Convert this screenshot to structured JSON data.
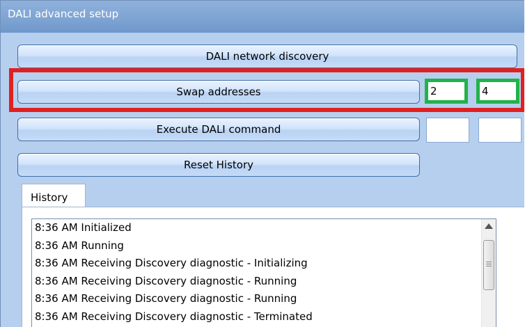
{
  "window": {
    "title": "DALI advanced setup"
  },
  "buttons": {
    "discovery": "DALI network discovery",
    "swap": "Swap addresses",
    "execute": "Execute DALI command",
    "reset": "Reset History"
  },
  "swap_fields": {
    "first": "2",
    "second": "4"
  },
  "command_fields": {
    "first": "",
    "second": ""
  },
  "tabs": [
    {
      "label": "History"
    }
  ],
  "history": [
    "8:36 AM Initialized",
    "8:36 AM Running",
    "8:36 AM Receiving Discovery diagnostic - Initializing",
    "8:36 AM Receiving Discovery diagnostic - Running",
    "8:36 AM Receiving Discovery diagnostic - Running",
    "8:36 AM Receiving Discovery diagnostic - Terminated"
  ],
  "colors": {
    "highlight_red": "#e02020",
    "highlight_green": "#21b24a"
  }
}
